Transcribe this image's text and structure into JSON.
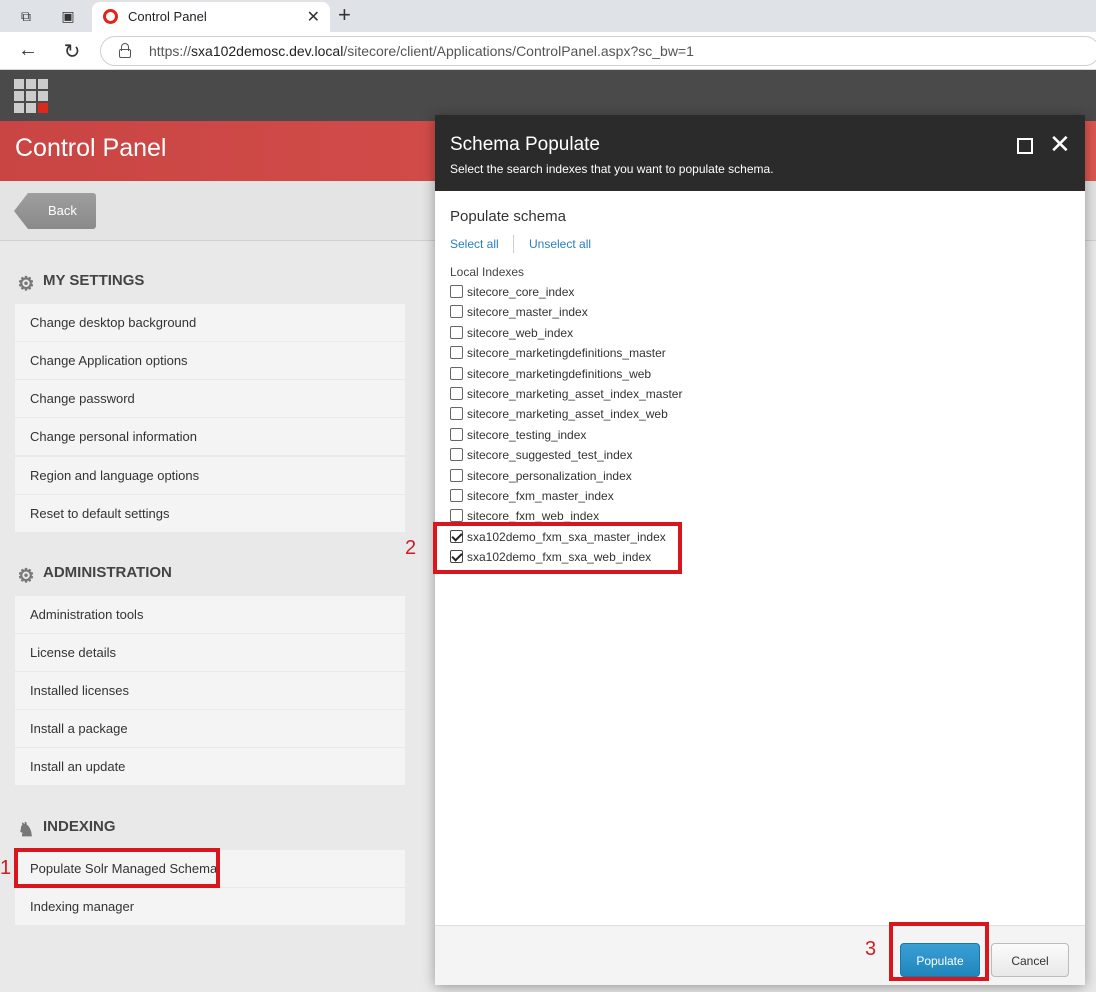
{
  "browser": {
    "tab_title": "Control Panel",
    "url_prefix": "https://",
    "url_host": "sxa102demosc.dev.local",
    "url_path": "/sitecore/client/Applications/ControlPanel.aspx?sc_bw=1"
  },
  "page": {
    "title": "Control Panel",
    "back_label": "Back"
  },
  "sections": {
    "my_settings": {
      "title": "MY SETTINGS",
      "items": [
        "Change desktop background",
        "Change Application options",
        "Change password",
        "Change personal information",
        "Region and language options",
        "Reset to default settings"
      ]
    },
    "administration": {
      "title": "ADMINISTRATION",
      "items": [
        "Administration tools",
        "License details",
        "Installed licenses",
        "Install a package",
        "Install an update"
      ]
    },
    "indexing": {
      "title": "INDEXING",
      "items": [
        "Populate Solr Managed Schema",
        "Indexing manager"
      ]
    }
  },
  "dialog": {
    "title": "Schema Populate",
    "subtitle": "Select the search indexes that you want to populate schema.",
    "heading": "Populate schema",
    "select_all": "Select all",
    "unselect_all": "Unselect all",
    "group_label": "Local Indexes",
    "indexes": [
      {
        "name": "sitecore_core_index",
        "checked": false
      },
      {
        "name": "sitecore_master_index",
        "checked": false
      },
      {
        "name": "sitecore_web_index",
        "checked": false
      },
      {
        "name": "sitecore_marketingdefinitions_master",
        "checked": false
      },
      {
        "name": "sitecore_marketingdefinitions_web",
        "checked": false
      },
      {
        "name": "sitecore_marketing_asset_index_master",
        "checked": false
      },
      {
        "name": "sitecore_marketing_asset_index_web",
        "checked": false
      },
      {
        "name": "sitecore_testing_index",
        "checked": false
      },
      {
        "name": "sitecore_suggested_test_index",
        "checked": false
      },
      {
        "name": "sitecore_personalization_index",
        "checked": false
      },
      {
        "name": "sitecore_fxm_master_index",
        "checked": false
      },
      {
        "name": "sitecore_fxm_web_index",
        "checked": false
      },
      {
        "name": "sxa102demo_fxm_sxa_master_index",
        "checked": true
      },
      {
        "name": "sxa102demo_fxm_sxa_web_index",
        "checked": true
      }
    ],
    "populate_label": "Populate",
    "cancel_label": "Cancel"
  },
  "annotations": [
    "1",
    "2",
    "3"
  ]
}
